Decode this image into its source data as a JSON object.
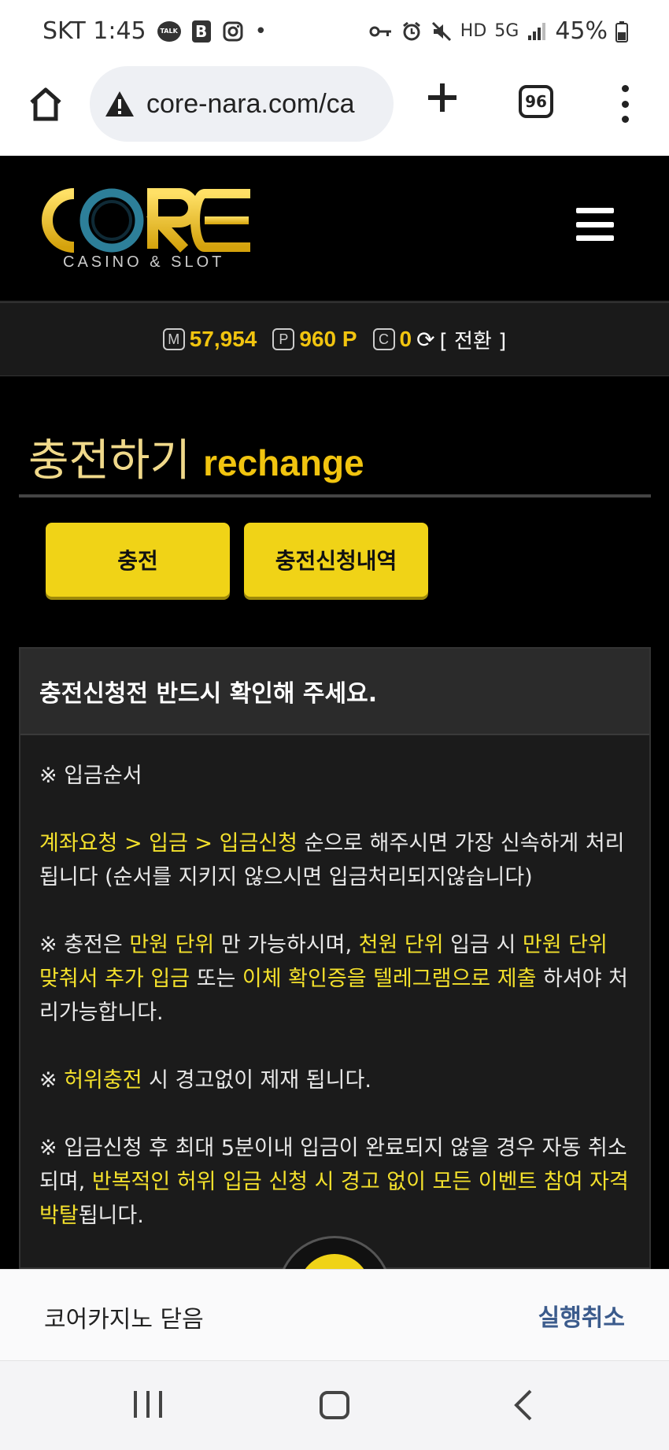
{
  "status_bar": {
    "carrier_time": "SKT 1:45",
    "talk_label": "TALK",
    "b_label": "B",
    "dot": "•",
    "voice_label": "HD",
    "network": "5G",
    "battery": "45%"
  },
  "browser": {
    "url": "core-nara.com/ca",
    "tab_count": "96"
  },
  "site": {
    "logo_text": "CORE",
    "logo_sub": "CASINO & SLOT"
  },
  "balance": {
    "money_badge": "M",
    "money_value": "57,954",
    "point_badge": "P",
    "point_value": "960 P",
    "coupon_badge": "C",
    "coupon_value": "0",
    "convert_label": "[ 전환 ]"
  },
  "page": {
    "title_ko": "충전하기",
    "title_en": "rechange",
    "btn_charge": "충전",
    "btn_history": "충전신청내역"
  },
  "notice": {
    "heading": "충전신청전 반드시 확인해 주세요.",
    "p1": "※ 입금순서",
    "p2_hl": "계좌요청 > 입금 > 입금신청",
    "p2_rest": " 순으로 해주시면 가장 신속하게 처리됩니다 (순서를 지키지 않으시면 입금처리되지않습니다)",
    "p3_a": "※ 충전은 ",
    "p3_b": "만원 단위",
    "p3_c": " 만 가능하시며, ",
    "p3_d": "천원 단위",
    "p3_e": " 입금 시 ",
    "p3_f": "만원 단위 맞춰서 추가 입금",
    "p3_g": " 또는 ",
    "p3_h": "이체 확인증을 텔레그램으로 제출",
    "p3_i": " 하셔야 처리가능합니다.",
    "p4_a": "※ ",
    "p4_b": "허위충전",
    "p4_c": " 시 경고없이 제재 됩니다.",
    "p5_a": "※ 입금신청 후 최대 5분이내 입금이 완료되지 않을 경우 자동 취소되며, ",
    "p5_b": "반복적인 허위 입금 신청 시 경고 없이 모든 이벤트 참여 자격 박탈",
    "p5_c": "됩니다."
  },
  "sheet": {
    "message": "코어카지노 닫음",
    "undo": "실행취소"
  },
  "colors": {
    "accent_yellow": "#f0d317",
    "highlight_text": "#f4e12c",
    "link_blue": "#3b5b8c"
  }
}
